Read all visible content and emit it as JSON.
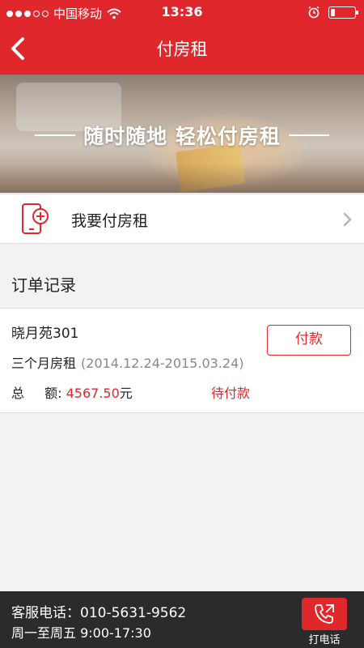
{
  "status_bar": {
    "carrier": "中国移动",
    "time": "13:36",
    "signal_bars_filled": 3,
    "signal_bars_total": 5,
    "battery_level": 0.2
  },
  "nav": {
    "title": "付房租"
  },
  "banner": {
    "slogan": "随时随地 轻松付房租"
  },
  "pay_entry": {
    "label": "我要付房租"
  },
  "orders_section": {
    "title": "订单记录"
  },
  "orders": [
    {
      "name": "晓月苑301",
      "period_label": "三个月房租",
      "period_range": "(2014.12.24-2015.03.24)",
      "amount_label_a": "总",
      "amount_label_b": "额:",
      "amount_value": "4567.50",
      "amount_unit": "元",
      "status": "待付款",
      "pay_button": "付款"
    }
  ],
  "footer": {
    "hotline": "客服电话：010-5631-9562",
    "hours": "周一至周五 9:00-17:30",
    "call_label": "打电话"
  },
  "colors": {
    "accent": "#e0272c",
    "footer_bg": "#2b2b2b",
    "page_bg": "#f2f2f2"
  },
  "icons": {
    "back": "chevron-left-icon",
    "pay": "phone-plus-icon",
    "row_chevron": "chevron-right-icon",
    "call": "phone-call-icon",
    "wifi": "wifi-icon",
    "alarm": "alarm-icon"
  }
}
